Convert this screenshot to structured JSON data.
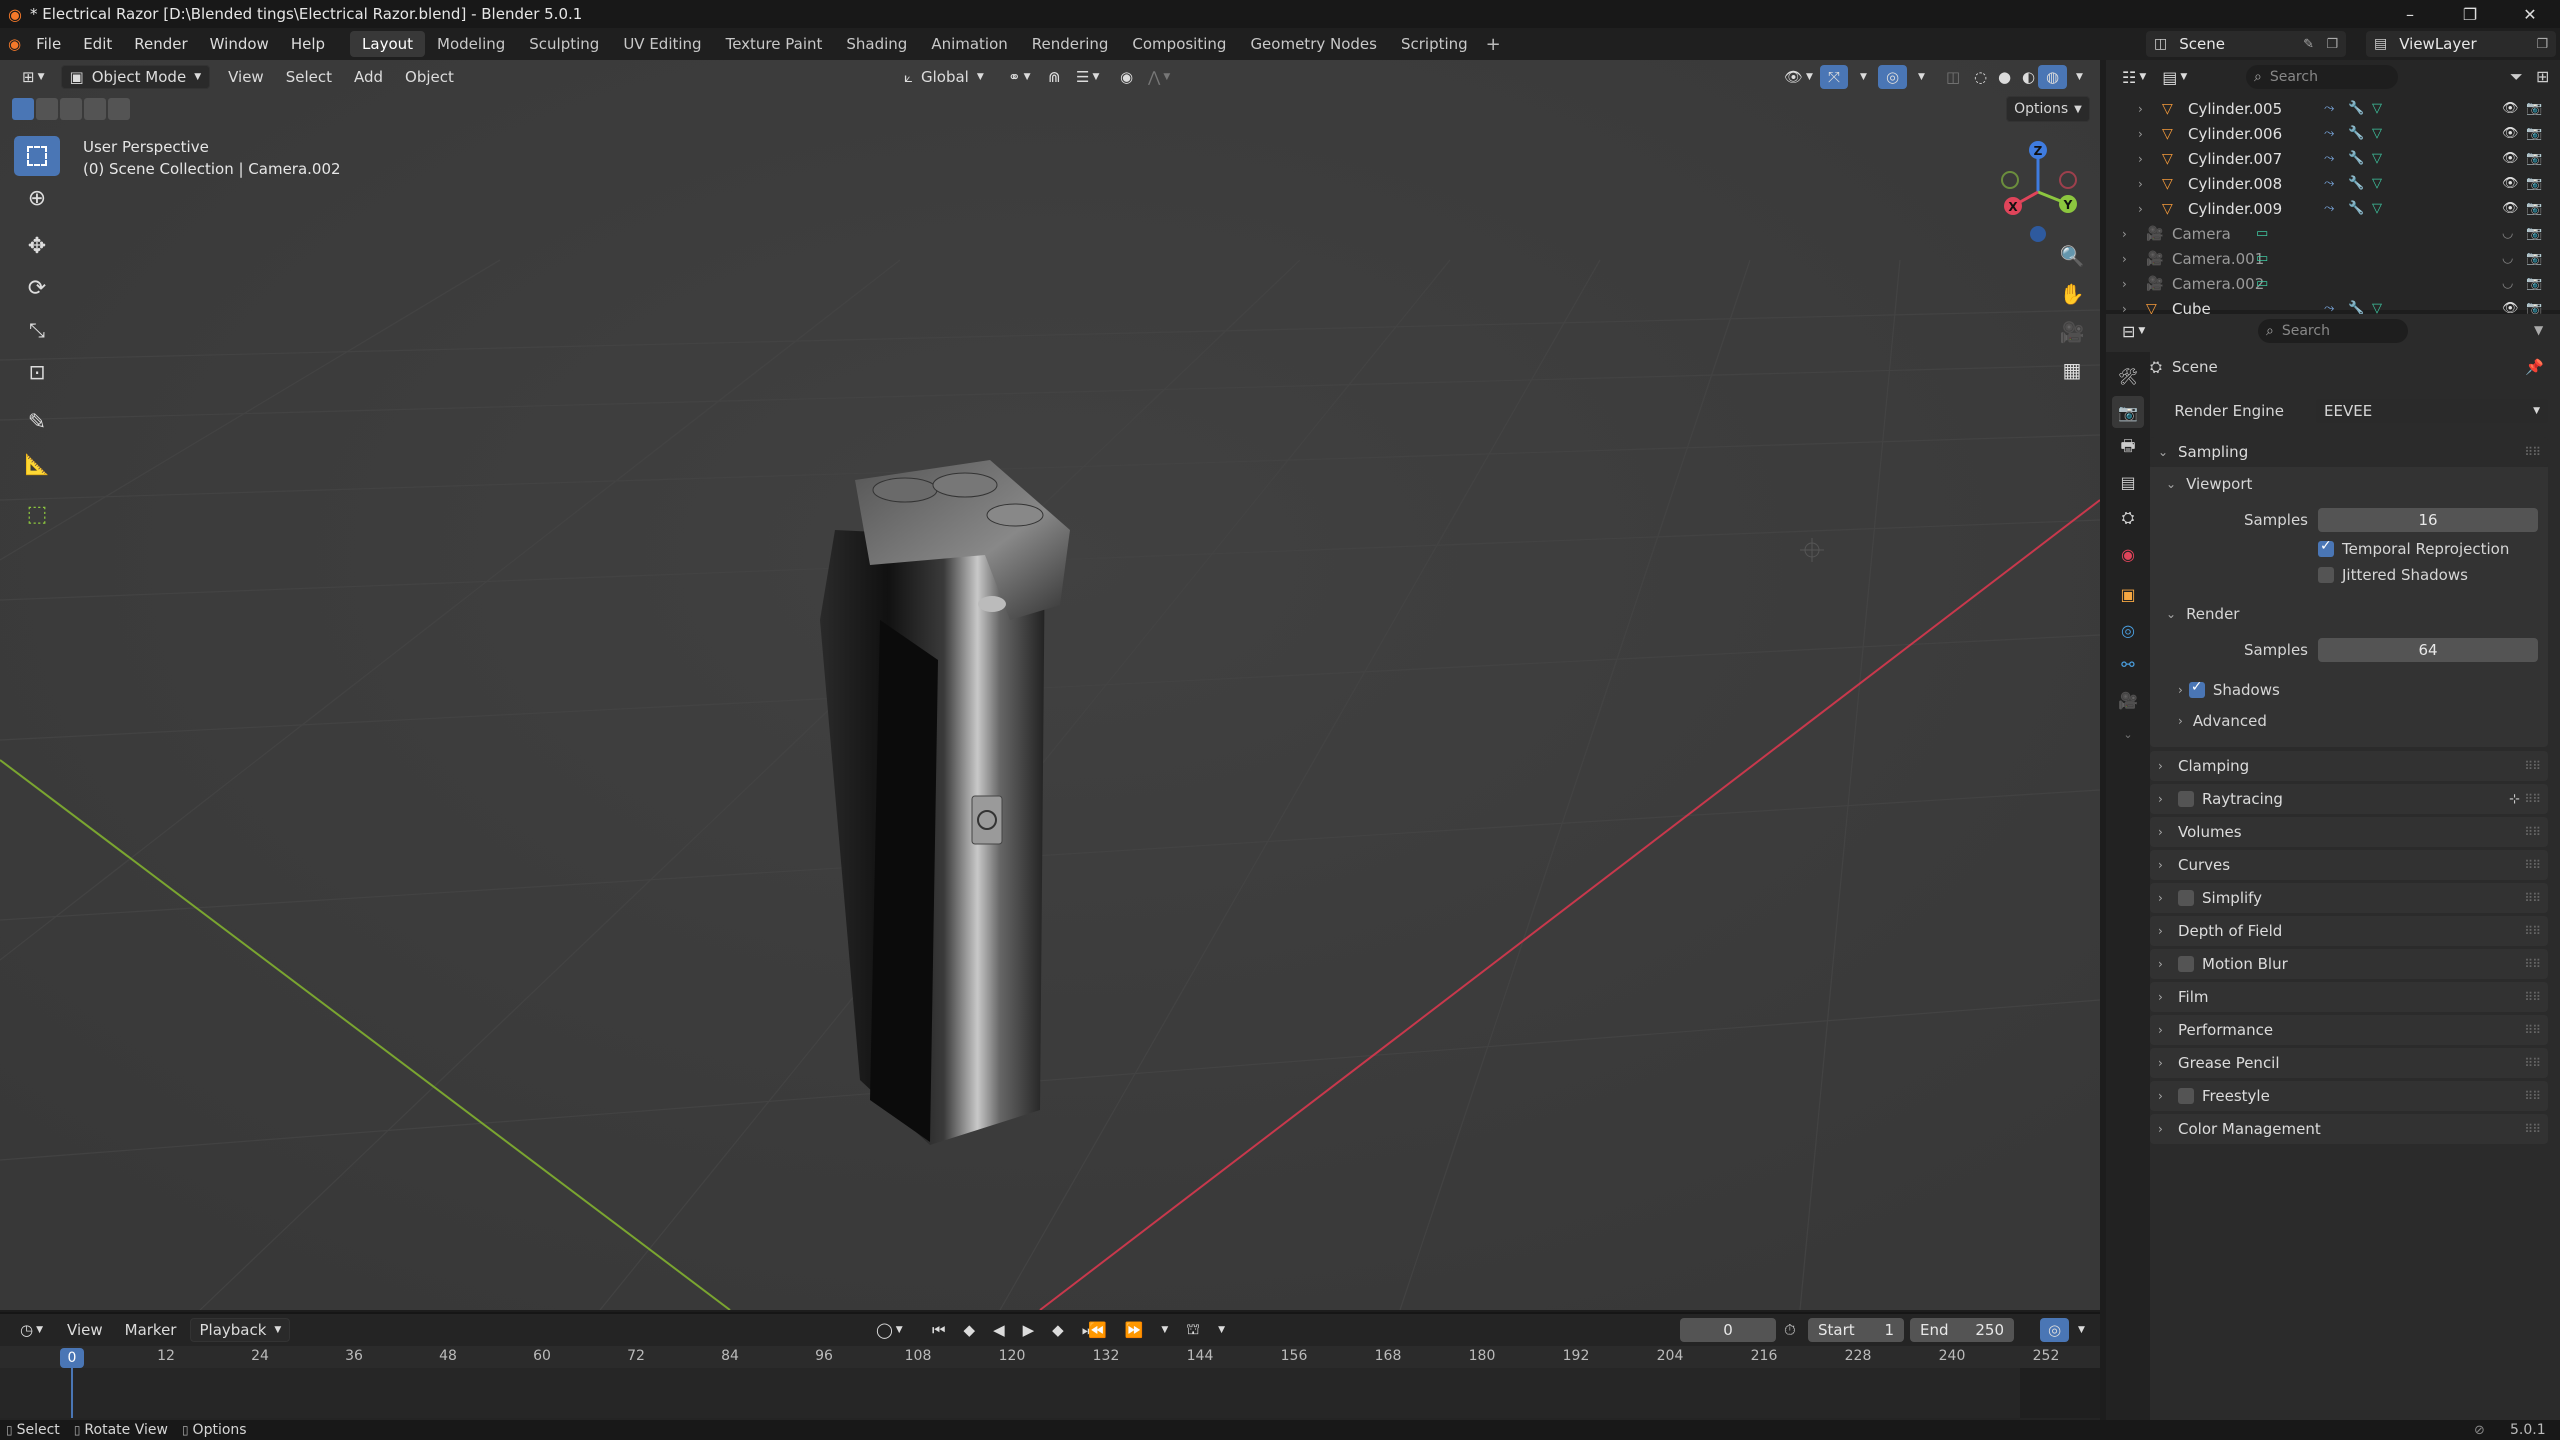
{
  "window": {
    "title": "* Electrical Razor [D:\\Blended tings\\Electrical Razor.blend] - Blender 5.0.1"
  },
  "menu": {
    "items": [
      "File",
      "Edit",
      "Render",
      "Window",
      "Help"
    ],
    "workspaces": [
      "Layout",
      "Modeling",
      "Sculpting",
      "UV Editing",
      "Texture Paint",
      "Shading",
      "Animation",
      "Rendering",
      "Compositing",
      "Geometry Nodes",
      "Scripting"
    ],
    "active_workspace": "Layout",
    "scene": "Scene",
    "view_layer": "ViewLayer"
  },
  "viewport": {
    "mode": "Object Mode",
    "menus": [
      "View",
      "Select",
      "Add",
      "Object"
    ],
    "transform_orientation": "Global",
    "options_label": "Options",
    "overlay_title": "User Perspective",
    "overlay_collection": "(0) Scene Collection | Camera.002",
    "gizmo": {
      "x": "X",
      "y": "Y",
      "z": "Z"
    }
  },
  "outliner": {
    "search_placeholder": "Search",
    "rows": [
      {
        "name": "Cylinder.005"
      },
      {
        "name": "Cylinder.006"
      },
      {
        "name": "Cylinder.007"
      },
      {
        "name": "Cylinder.008"
      },
      {
        "name": "Cylinder.009"
      },
      {
        "name": "Camera"
      },
      {
        "name": "Camera.001"
      },
      {
        "name": "Camera.002"
      },
      {
        "name": "Cube"
      }
    ]
  },
  "properties": {
    "search_placeholder": "Search",
    "context": "Scene",
    "render_engine_label": "Render Engine",
    "render_engine": "EEVEE",
    "sampling": {
      "label": "Sampling",
      "viewport_label": "Viewport",
      "viewport_samples_label": "Samples",
      "viewport_samples": "16",
      "temporal_reprojection": "Temporal Reprojection",
      "jittered_shadows": "Jittered Shadows",
      "render_label": "Render",
      "render_samples_label": "Samples",
      "render_samples": "64",
      "shadows": "Shadows",
      "advanced": "Advanced"
    },
    "panels": [
      "Clamping",
      "Raytracing",
      "Volumes",
      "Curves",
      "Simplify",
      "Depth of Field",
      "Motion Blur",
      "Film",
      "Performance",
      "Grease Pencil",
      "Freestyle",
      "Color Management"
    ]
  },
  "timeline": {
    "menus": [
      "View",
      "Marker",
      "Playback"
    ],
    "current_frame": "0",
    "start_label": "Start",
    "start": "1",
    "end_label": "End",
    "end": "250",
    "ruler": [
      "0",
      "12",
      "24",
      "36",
      "48",
      "60",
      "72",
      "84",
      "96",
      "108",
      "120",
      "132",
      "144",
      "156",
      "168",
      "180",
      "192",
      "204",
      "216",
      "228",
      "240",
      "252"
    ]
  },
  "status": {
    "select": "Select",
    "rotate": "Rotate View",
    "options": "Options",
    "version": "5.0.1"
  },
  "colors": {
    "accent": "#4a76b5",
    "axis_x": "#e0445a",
    "axis_y": "#8cc63f",
    "axis_z": "#3f7ce0"
  }
}
